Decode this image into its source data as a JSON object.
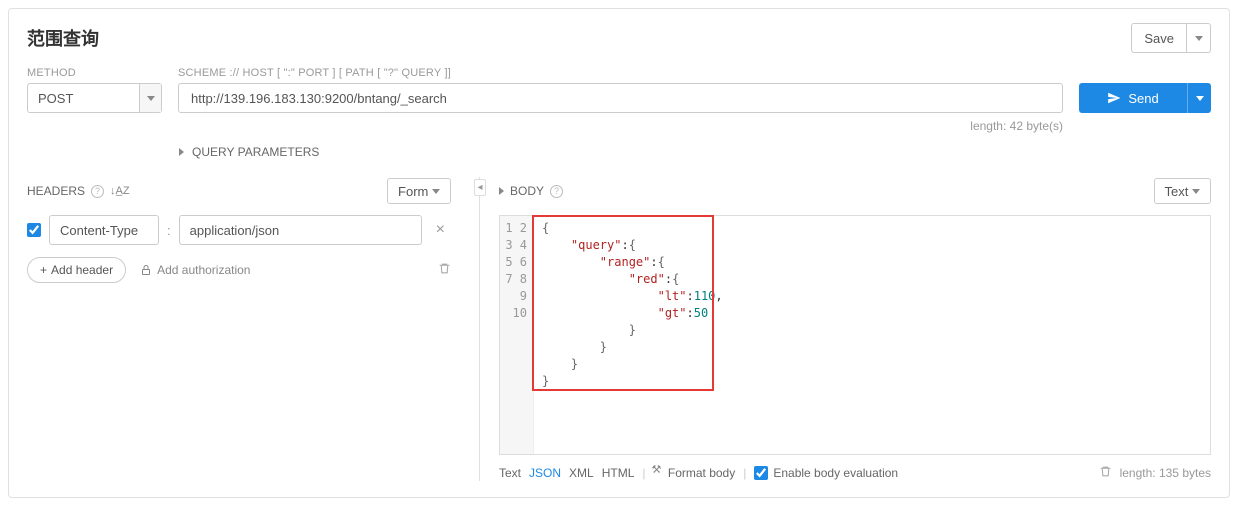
{
  "title": "范围查询",
  "save": {
    "label": "Save"
  },
  "method": {
    "label": "METHOD",
    "value": "POST"
  },
  "url": {
    "label": "SCHEME :// HOST [ \":\" PORT ] [ PATH [ \"?\" QUERY ]]",
    "value": "http://139.196.183.130:9200/bntang/_search"
  },
  "url_length": "length: 42 byte(s)",
  "send": {
    "label": "Send"
  },
  "query_params": "QUERY PARAMETERS",
  "headers": {
    "title": "HEADERS",
    "form_label": "Form",
    "rows": [
      {
        "name": "Content-Type",
        "value": "application/json"
      }
    ],
    "add_header": "Add header",
    "add_auth": "Add authorization"
  },
  "body": {
    "title": "BODY",
    "mode_label": "Text",
    "lines": [
      "1",
      "2",
      "3",
      "4",
      "5",
      "6",
      "7",
      "8",
      "9",
      "10"
    ],
    "code_tokens": [
      [
        {
          "t": "brace",
          "v": "{"
        }
      ],
      [
        {
          "t": "plain",
          "v": "    "
        },
        {
          "t": "key",
          "v": "\"query\""
        },
        {
          "t": "plain",
          "v": ":"
        },
        {
          "t": "brace",
          "v": "{"
        }
      ],
      [
        {
          "t": "plain",
          "v": "        "
        },
        {
          "t": "key",
          "v": "\"range\""
        },
        {
          "t": "plain",
          "v": ":"
        },
        {
          "t": "brace",
          "v": "{"
        }
      ],
      [
        {
          "t": "plain",
          "v": "            "
        },
        {
          "t": "key",
          "v": "\"red\""
        },
        {
          "t": "plain",
          "v": ":"
        },
        {
          "t": "brace",
          "v": "{"
        }
      ],
      [
        {
          "t": "plain",
          "v": "                "
        },
        {
          "t": "key",
          "v": "\"lt\""
        },
        {
          "t": "plain",
          "v": ":"
        },
        {
          "t": "num",
          "v": "110"
        },
        {
          "t": "plain",
          "v": ","
        }
      ],
      [
        {
          "t": "plain",
          "v": "                "
        },
        {
          "t": "key",
          "v": "\"gt\""
        },
        {
          "t": "plain",
          "v": ":"
        },
        {
          "t": "num",
          "v": "50"
        }
      ],
      [
        {
          "t": "plain",
          "v": "            "
        },
        {
          "t": "brace",
          "v": "}"
        }
      ],
      [
        {
          "t": "plain",
          "v": "        "
        },
        {
          "t": "brace",
          "v": "}"
        }
      ],
      [
        {
          "t": "plain",
          "v": "    "
        },
        {
          "t": "brace",
          "v": "}"
        }
      ],
      [
        {
          "t": "brace",
          "v": "}"
        }
      ]
    ],
    "footer": {
      "text": "Text",
      "json": "JSON",
      "xml": "XML",
      "html": "HTML",
      "format": "Format body",
      "enable_eval": "Enable body evaluation",
      "length": "length: 135 bytes"
    }
  }
}
